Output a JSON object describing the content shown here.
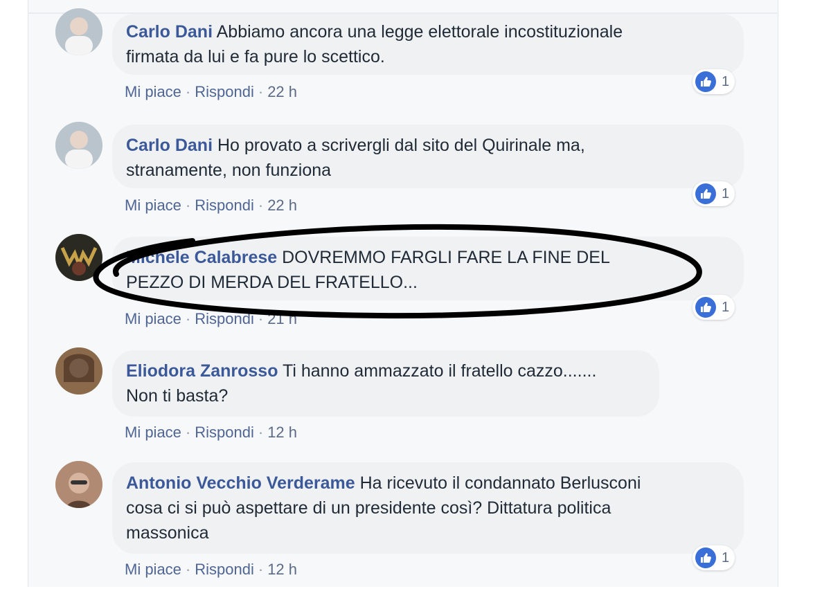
{
  "comments": [
    {
      "author": "Carlo Dani",
      "lines": [
        "Abbiamo ancora una legge elettorale incostituzionale",
        "firmata da lui e fa pure lo scettico."
      ],
      "like": "Mi piace",
      "reply": "Rispondi",
      "time": "22 h",
      "reactions": "1"
    },
    {
      "author": "Carlo Dani",
      "lines": [
        "Ho provato a scrivergli dal sito del Quirinale ma,",
        "stranamente, non funziona"
      ],
      "like": "Mi piace",
      "reply": "Rispondi",
      "time": "22 h",
      "reactions": "1"
    },
    {
      "author": "Michele Calabrese",
      "lines": [
        "DOVREMMO FARGLI FARE LA FINE DEL",
        "PEZZO DI MERDA DEL FRATELLO..."
      ],
      "like": "Mi piace",
      "reply": "Rispondi",
      "time": "21 h",
      "reactions": "1"
    },
    {
      "author": "Eliodora Zanrosso",
      "lines": [
        "Ti hanno ammazzato il fratello cazzo.......",
        "Non ti basta?"
      ],
      "like": "Mi piace",
      "reply": "Rispondi",
      "time": "12 h",
      "reactions": ""
    },
    {
      "author": "Antonio Vecchio Verderame",
      "lines": [
        "Ha ricevuto il condannato Berlusconi",
        "cosa ci si può aspettare di un presidente così? Dittatura politica",
        "massonica"
      ],
      "like": "Mi piace",
      "reply": "Rispondi",
      "time": "12 h",
      "reactions": "1"
    }
  ],
  "colors": {
    "author": "#3b5998",
    "like_icon": "#3a6fd8",
    "highlight_ellipse": "#000000"
  }
}
